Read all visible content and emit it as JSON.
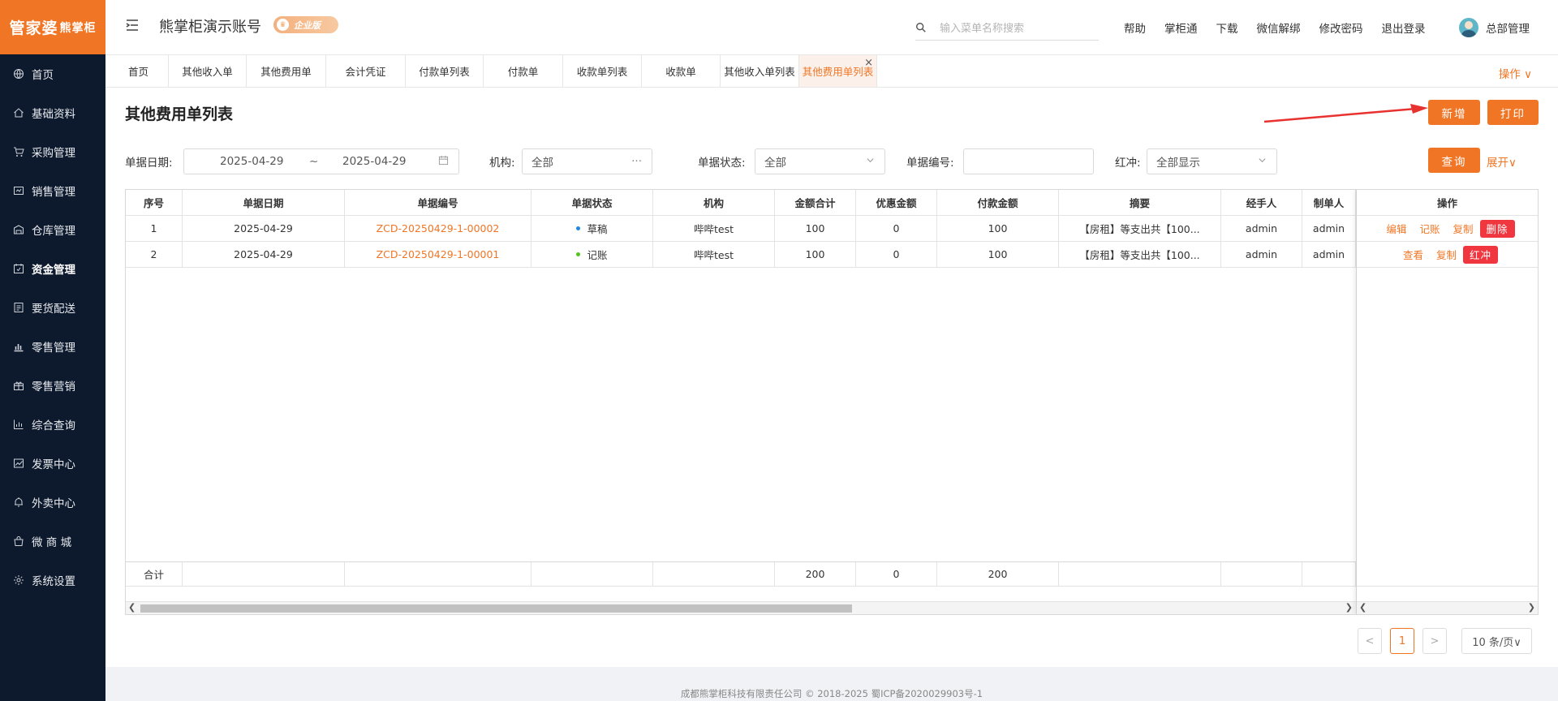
{
  "brand": {
    "logo_part1": "管家婆",
    "logo_part2": "熊掌柜"
  },
  "sidebar": {
    "items": [
      {
        "label": "首页",
        "icon": "globe-icon"
      },
      {
        "label": "基础资料",
        "icon": "home-icon"
      },
      {
        "label": "采购管理",
        "icon": "cart-icon"
      },
      {
        "label": "销售管理",
        "icon": "sales-icon"
      },
      {
        "label": "仓库管理",
        "icon": "warehouse-icon"
      },
      {
        "label": "资金管理",
        "icon": "calendar-icon",
        "active": true
      },
      {
        "label": "要货配送",
        "icon": "list-icon"
      },
      {
        "label": "零售管理",
        "icon": "bar-chart-icon"
      },
      {
        "label": "零售营销",
        "icon": "gift-icon"
      },
      {
        "label": "综合查询",
        "icon": "column-chart-icon"
      },
      {
        "label": "发票中心",
        "icon": "trend-icon"
      },
      {
        "label": "外卖中心",
        "icon": "bell-icon"
      },
      {
        "label": "微 商 城",
        "icon": "shop-icon"
      },
      {
        "label": "系统设置",
        "icon": "gear-icon"
      }
    ]
  },
  "header": {
    "account_title": "熊掌柜演示账号",
    "edition_badge": "企业版",
    "search_placeholder": "输入菜单名称搜索",
    "links": [
      "帮助",
      "掌柜通",
      "下载",
      "微信解绑",
      "修改密码",
      "退出登录"
    ],
    "user_name": "总部管理"
  },
  "tabs": [
    "首页",
    "其他收入单",
    "其他费用单",
    "会计凭证",
    "付款单列表",
    "付款单",
    "收款单列表",
    "收款单",
    "其他收入单列表",
    "其他费用单列表"
  ],
  "active_tab": "其他费用单列表",
  "ops_label": "操作 ∨",
  "page": {
    "title": "其他费用单列表",
    "add_label": "新增",
    "print_label": "打印"
  },
  "filters": {
    "date_label": "单据日期:",
    "date_from": "2025-04-29",
    "date_sep": "~",
    "date_to": "2025-04-29",
    "org_label": "机构:",
    "org_value": "全部",
    "status_label": "单据状态:",
    "status_value": "全部",
    "number_label": "单据编号:",
    "number_value": "",
    "redflush_label": "红冲:",
    "redflush_value": "全部显示",
    "query_label": "查询",
    "expand_label": "展开∨"
  },
  "table": {
    "columns": [
      "序号",
      "单据日期",
      "单据编号",
      "单据状态",
      "机构",
      "金额合计",
      "优惠金额",
      "付款金额",
      "摘要",
      "经手人",
      "制单人",
      "操作"
    ],
    "rows": [
      {
        "seq": "1",
        "date": "2025-04-29",
        "number": "ZCD-20250429-1-00002",
        "status": "草稿",
        "status_color": "#1e88e5",
        "org": "哔哔test",
        "total": "100",
        "discount": "0",
        "paid": "100",
        "summary": "【房租】等支出共【100...",
        "handler": "admin",
        "creator": "admin",
        "actions": [
          "编辑",
          "记账",
          "复制"
        ],
        "danger": "删除"
      },
      {
        "seq": "2",
        "date": "2025-04-29",
        "number": "ZCD-20250429-1-00001",
        "status": "记账",
        "status_color": "#52c41a",
        "org": "哔哔test",
        "total": "100",
        "discount": "0",
        "paid": "100",
        "summary": "【房租】等支出共【100...",
        "handler": "admin",
        "creator": "admin",
        "actions": [
          "查看",
          "复制"
        ],
        "danger": "红冲"
      }
    ],
    "totals": {
      "label": "合计",
      "total": "200",
      "discount": "0",
      "paid": "200"
    }
  },
  "pagination": {
    "prev": "<",
    "page": "1",
    "next": ">",
    "page_size": "10 条/页∨"
  },
  "footer": "成都熊掌柜科技有限责任公司 © 2018-2025 蜀ICP备2020029903号-1",
  "colors": {
    "accent": "#f07626",
    "sidebar_bg": "#0d1a2e",
    "danger": "#f0363f"
  }
}
